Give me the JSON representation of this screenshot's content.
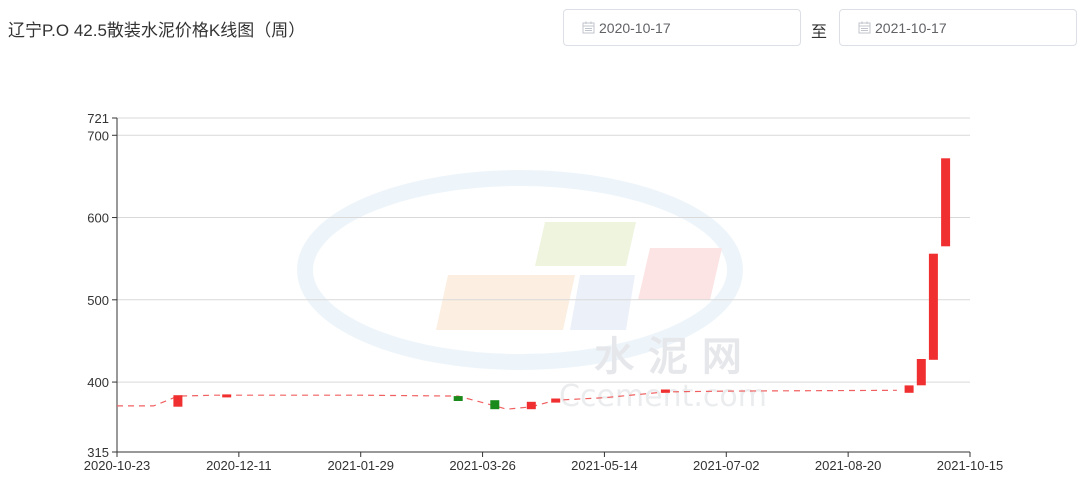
{
  "header": {
    "title": "辽宁P.O 42.5散装水泥价格K线图（周）",
    "start_date": "2020-10-17",
    "separator": "至",
    "end_date": "2021-10-17",
    "calendar_icon": "calendar-icon"
  },
  "watermark": {
    "line1": "水 泥 网",
    "line2": "Ccement.com"
  },
  "colors": {
    "rise": "#f03030",
    "fall": "#1a8a1a",
    "avg_line": "#f06060",
    "grid": "#d9d9d9",
    "axis": "#333333"
  },
  "chart_data": {
    "type": "candlestick",
    "title": "辽宁P.O 42.5散装水泥价格K线图（周）",
    "xlabel": "",
    "ylabel": "",
    "ylim": [
      315,
      721
    ],
    "yticks": [
      315,
      400,
      500,
      600,
      700,
      721
    ],
    "x_tick_labels": [
      "2020-10-23",
      "2020-12-11",
      "2021-01-29",
      "2021-03-26",
      "2021-05-14",
      "2021-07-02",
      "2021-08-20",
      "2021-10-15"
    ],
    "grid": true,
    "candles": [
      {
        "week": 5,
        "open": 370,
        "close": 384
      },
      {
        "week": 9,
        "open": 383,
        "close": 385
      },
      {
        "week": 28,
        "open": 383,
        "close": 377
      },
      {
        "week": 31,
        "open": 378,
        "close": 367
      },
      {
        "week": 34,
        "open": 367,
        "close": 376
      },
      {
        "week": 36,
        "open": 375,
        "close": 380
      },
      {
        "week": 45,
        "open": 387,
        "close": 391
      },
      {
        "week": 65,
        "open": 387,
        "close": 396
      },
      {
        "week": 66,
        "open": 396,
        "close": 428
      },
      {
        "week": 67,
        "open": 427,
        "close": 556
      },
      {
        "week": 68,
        "open": 565,
        "close": 672
      }
    ],
    "avg_line": [
      {
        "week": 0,
        "value": 371
      },
      {
        "week": 3,
        "value": 371
      },
      {
        "week": 5,
        "value": 383
      },
      {
        "week": 8,
        "value": 384
      },
      {
        "week": 20,
        "value": 384
      },
      {
        "week": 28,
        "value": 383
      },
      {
        "week": 30,
        "value": 375
      },
      {
        "week": 32,
        "value": 367
      },
      {
        "week": 34,
        "value": 370
      },
      {
        "week": 36,
        "value": 378
      },
      {
        "week": 40,
        "value": 381
      },
      {
        "week": 45,
        "value": 388
      },
      {
        "week": 50,
        "value": 389
      },
      {
        "week": 64,
        "value": 390
      }
    ]
  }
}
